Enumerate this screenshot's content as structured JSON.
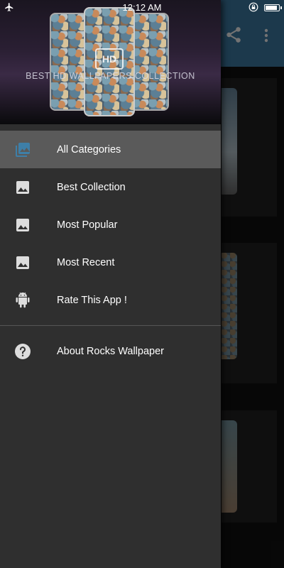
{
  "status_bar": {
    "time": "12:12 AM",
    "battery_level": 0.8
  },
  "drawer": {
    "header_title": "BEST HD WALLPAPERS COLLECTION",
    "logo_text": "HD",
    "items": [
      {
        "label": "All Categories",
        "icon": "gallery-icon",
        "active": true
      },
      {
        "label": "Best Collection",
        "icon": "image-icon"
      },
      {
        "label": "Most Popular",
        "icon": "image-icon"
      },
      {
        "label": "Most Recent",
        "icon": "image-icon"
      },
      {
        "label": "Rate This App !",
        "icon": "android-icon"
      }
    ],
    "footer_item": {
      "label": "About Rocks Wallpaper",
      "icon": "help-icon"
    }
  },
  "colors": {
    "accent": "#3e7fa8",
    "drawer_bg": "#2f2f2f",
    "active_item_bg": "#5a5a5a"
  }
}
